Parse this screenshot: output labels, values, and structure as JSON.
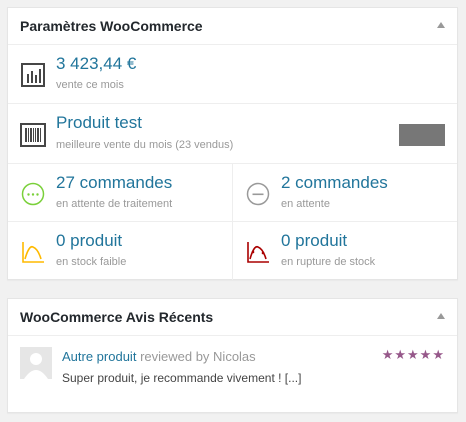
{
  "colors": {
    "link": "#21759b",
    "processing": "#7ad03a",
    "on_hold": "#999999",
    "low_stock": "#ffba00",
    "out_of_stock": "#a00000",
    "stars": "#96588a"
  },
  "status_widget": {
    "title": "Paramètres WooCommerce",
    "sales": {
      "icon": "bar-chart-icon",
      "value": "3 423,44 €",
      "label": "vente ce mois"
    },
    "top_seller": {
      "icon": "barcode-icon",
      "value": "Produit test",
      "label": "meilleure vente du mois (23 vendus)"
    },
    "processing": {
      "icon": "processing-icon",
      "value": "27 commandes",
      "label": "en attente de traitement"
    },
    "on_hold": {
      "icon": "on-hold-icon",
      "value": "2 commandes",
      "label": "en attente"
    },
    "low_stock": {
      "icon": "low-stock-icon",
      "value": "0 produit",
      "label": "en stock faible"
    },
    "out_of_stock": {
      "icon": "out-of-stock-icon",
      "value": "0 produit",
      "label": "en rupture de stock"
    }
  },
  "reviews_widget": {
    "title": "WooCommerce Avis Récents",
    "reviews": [
      {
        "product": "Autre produit",
        "reviewed_by": "reviewed by Nicolas",
        "text": "Super produit, je recommande vivement ! [...]",
        "rating": 5,
        "stars": "★★★★★"
      }
    ]
  }
}
